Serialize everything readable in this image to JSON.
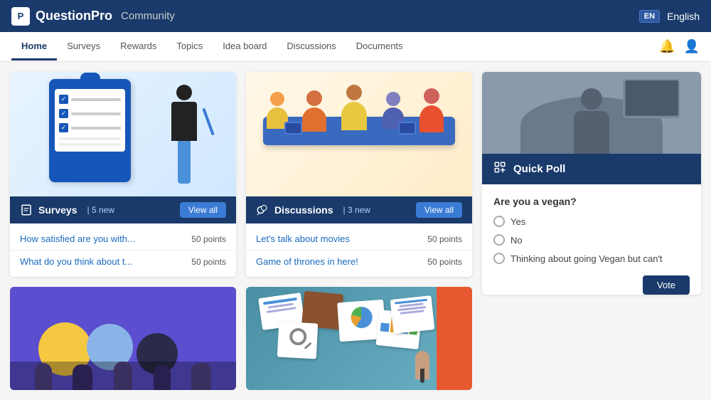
{
  "header": {
    "logo_text": "P",
    "brand": "QuestionPro",
    "community": "Community",
    "lang_code": "EN",
    "lang_label": "English"
  },
  "nav": {
    "items": [
      {
        "id": "home",
        "label": "Home",
        "active": true
      },
      {
        "id": "surveys",
        "label": "Surveys",
        "active": false
      },
      {
        "id": "rewards",
        "label": "Rewards",
        "active": false
      },
      {
        "id": "topics",
        "label": "Topics",
        "active": false
      },
      {
        "id": "idea-board",
        "label": "Idea board",
        "active": false
      },
      {
        "id": "discussions",
        "label": "Discussions",
        "active": false
      },
      {
        "id": "documents",
        "label": "Documents",
        "active": false
      }
    ]
  },
  "surveys_card": {
    "title": "Surveys",
    "new_count": "5 new",
    "view_all": "View all",
    "items": [
      {
        "label": "How satisfied are you with...",
        "points": "50 points"
      },
      {
        "label": "What do you think about t...",
        "points": "50 points"
      }
    ]
  },
  "discussions_card": {
    "title": "Discussions",
    "new_count": "3 new",
    "view_all": "View all",
    "items": [
      {
        "label": "Let's talk about movies",
        "points": "50 points"
      },
      {
        "label": "Game of thrones in here!",
        "points": "50 points"
      }
    ]
  },
  "quick_poll": {
    "title": "Quick Poll",
    "question": "Are you a vegan?",
    "options": [
      {
        "id": "yes",
        "label": "Yes"
      },
      {
        "id": "no",
        "label": "No"
      },
      {
        "id": "thinking",
        "label": "Thinking about going Vegan but can't"
      }
    ],
    "vote_label": "Vote"
  }
}
